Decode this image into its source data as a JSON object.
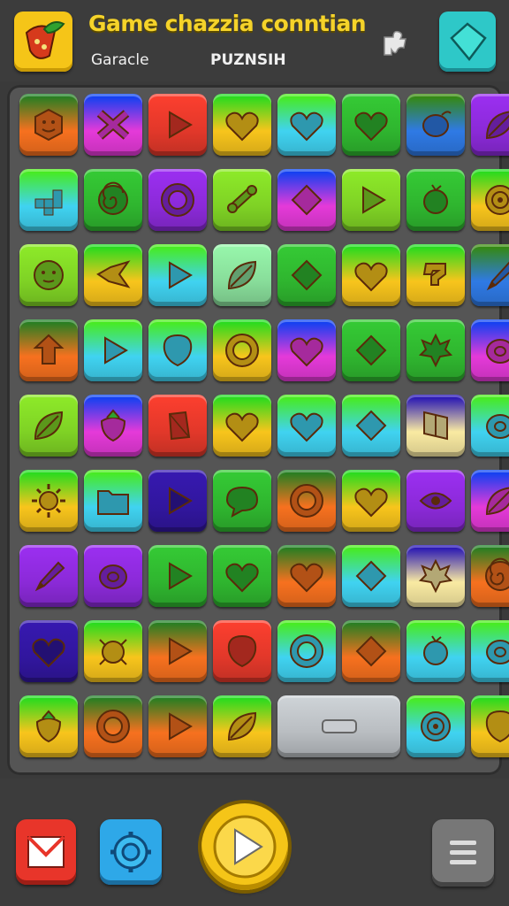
{
  "header": {
    "title": "Game chazzia conntian",
    "subtitle_left": "Garacle",
    "subtitle_right": "PUZNSIH"
  },
  "colors": {
    "orange": "#f7711f",
    "magenta": "#e53ad9",
    "red": "#e2382a",
    "yellow": "#f8c51c",
    "cyan": "#40d3f1",
    "green": "#2fb52f",
    "lime": "#7fd225",
    "blue": "#2f7ae5",
    "purple": "#8b2ad8",
    "navy": "#31169e",
    "mint": "#88dd9a",
    "grey": "#b9bdc1",
    "cream": "#f9eaa2"
  },
  "grid": [
    [
      {
        "c": "orange",
        "i": "hex-face-icon"
      },
      {
        "c": "magenta",
        "i": "cross-icon"
      },
      {
        "c": "red",
        "i": "play-arrow-icon"
      },
      {
        "c": "yellow",
        "i": "heart-icon"
      },
      {
        "c": "cyan",
        "i": "heart-icon"
      },
      {
        "c": "green",
        "i": "heart-icon"
      },
      {
        "c": "blue",
        "i": "lime-fruit-icon"
      },
      {
        "c": "purple",
        "i": "leaf-icon"
      }
    ],
    [
      {
        "c": "cyan",
        "i": "pixel-blocks-icon"
      },
      {
        "c": "green",
        "i": "spiral-icon"
      },
      {
        "c": "purple",
        "i": "ring-icon"
      },
      {
        "c": "lime",
        "i": "bone-icon"
      },
      {
        "c": "magenta",
        "i": "diamond-icon"
      },
      {
        "c": "lime",
        "i": "play-arrow-icon"
      },
      {
        "c": "green",
        "i": "orange-fruit-icon"
      },
      {
        "c": "yellow",
        "i": "target-icon"
      }
    ],
    [
      {
        "c": "lime",
        "i": "smiley-icon"
      },
      {
        "c": "yellow",
        "i": "bird-icon"
      },
      {
        "c": "cyan",
        "i": "play-arrow-icon"
      },
      {
        "c": "mint",
        "i": "leaf-icon"
      },
      {
        "c": "green",
        "i": "diamond-icon"
      },
      {
        "c": "yellow",
        "i": "heart-icon"
      },
      {
        "c": "yellow",
        "i": "question-icon"
      },
      {
        "c": "blue",
        "i": "pencil-icon"
      }
    ],
    [
      {
        "c": "orange",
        "i": "arrow-up-icon"
      },
      {
        "c": "cyan",
        "i": "play-arrow-icon"
      },
      {
        "c": "cyan",
        "i": "balloon-icon"
      },
      {
        "c": "yellow",
        "i": "ring-icon"
      },
      {
        "c": "magenta",
        "i": "heart-icon"
      },
      {
        "c": "green",
        "i": "diamond-icon"
      },
      {
        "c": "green",
        "i": "maple-leaf-icon"
      },
      {
        "c": "magenta",
        "i": "lemon-icon"
      }
    ],
    [
      {
        "c": "lime",
        "i": "leaf-icon"
      },
      {
        "c": "magenta",
        "i": "strawberry-icon"
      },
      {
        "c": "red",
        "i": "gem-icon"
      },
      {
        "c": "yellow",
        "i": "heart-icon"
      },
      {
        "c": "cyan",
        "i": "heart-icon"
      },
      {
        "c": "cyan",
        "i": "diamond-icon"
      },
      {
        "c": "cream",
        "i": "flag-icon"
      },
      {
        "c": "cyan",
        "i": "lemon-icon"
      }
    ],
    [
      {
        "c": "yellow",
        "i": "sun-icon"
      },
      {
        "c": "cyan",
        "i": "folder-icon"
      },
      {
        "c": "navy",
        "i": "play-arrow-icon"
      },
      {
        "c": "green",
        "i": "speech-bubble-icon"
      },
      {
        "c": "orange",
        "i": "ring-icon"
      },
      {
        "c": "yellow",
        "i": "heart-icon"
      },
      {
        "c": "purple",
        "i": "eye-icon"
      },
      {
        "c": "magenta",
        "i": "leaf-icon"
      }
    ],
    [
      {
        "c": "purple",
        "i": "pencil-icon"
      },
      {
        "c": "purple",
        "i": "lemon-icon"
      },
      {
        "c": "green",
        "i": "play-arrow-icon"
      },
      {
        "c": "green",
        "i": "heart-icon"
      },
      {
        "c": "orange",
        "i": "heart-icon"
      },
      {
        "c": "cyan",
        "i": "diamond-icon"
      },
      {
        "c": "cream",
        "i": "maple-leaf-icon"
      },
      {
        "c": "orange",
        "i": "spiral-icon"
      }
    ],
    [
      {
        "c": "navy",
        "i": "heart-icon"
      },
      {
        "c": "yellow",
        "i": "bug-icon"
      },
      {
        "c": "orange",
        "i": "play-arrow-icon"
      },
      {
        "c": "red",
        "i": "balloon-icon"
      },
      {
        "c": "cyan",
        "i": "ring-icon"
      },
      {
        "c": "orange",
        "i": "diamond-icon"
      },
      {
        "c": "cyan",
        "i": "orange-fruit-icon"
      },
      {
        "c": "cyan",
        "i": "lemon-icon"
      }
    ],
    [
      {
        "c": "yellow",
        "i": "strawberry-icon"
      },
      {
        "c": "orange",
        "i": "ring-icon"
      },
      {
        "c": "orange",
        "i": "play-arrow-icon"
      },
      {
        "c": "yellow",
        "i": "leaf-icon"
      },
      {
        "c": "grey",
        "i": "blank-block-icon",
        "wide": true
      },
      {
        "c": "cyan",
        "i": "target-icon"
      },
      {
        "c": "yellow",
        "i": "balloon-icon"
      }
    ]
  ]
}
